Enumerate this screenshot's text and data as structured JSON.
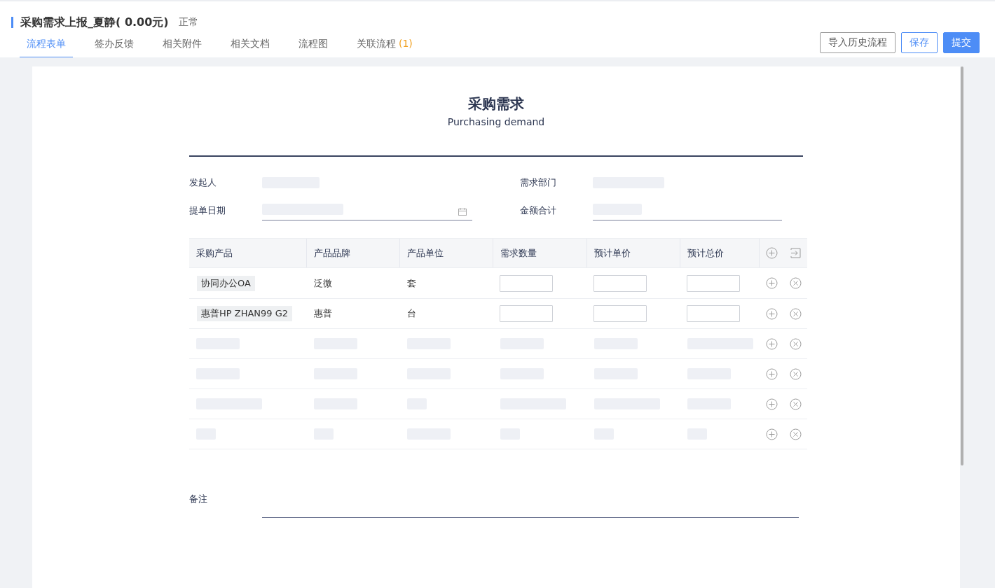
{
  "header": {
    "title": "采购需求上报_夏静( 0.00元)",
    "status": "正常"
  },
  "tabs": [
    {
      "label": "流程表单",
      "selected": true
    },
    {
      "label": "签办反馈",
      "selected": false
    },
    {
      "label": "相关附件",
      "selected": false
    },
    {
      "label": "相关文档",
      "selected": false
    },
    {
      "label": "流程图",
      "selected": false
    },
    {
      "label": "关联流程",
      "count": "(1)",
      "selected": false
    }
  ],
  "actions": [
    {
      "label": "导入历史流程",
      "kind": "default"
    },
    {
      "label": "保存",
      "kind": "outline"
    },
    {
      "label": "提交",
      "kind": "primary"
    }
  ],
  "form": {
    "title": "采购需求",
    "subtitle": "Purchasing demand",
    "fields": [
      {
        "label": "发起人",
        "kind": "readonly"
      },
      {
        "label": "需求部门",
        "kind": "readonly"
      },
      {
        "label": "提单日期",
        "kind": "date"
      },
      {
        "label": "金额合计",
        "kind": "input"
      }
    ],
    "table": {
      "columns": [
        "采购产品",
        "产品品牌",
        "产品单位",
        "需求数量",
        "预计单价",
        "预计总价"
      ],
      "rows": [
        {
          "kind": "item",
          "product": "协同办公OA",
          "brand": "泛微",
          "unit": "套"
        },
        {
          "kind": "item",
          "product": "惠普HP ZHAN99 G2",
          "brand": "惠普",
          "unit": "台"
        },
        {
          "kind": "placeholder"
        },
        {
          "kind": "placeholder"
        },
        {
          "kind": "placeholder"
        },
        {
          "kind": "placeholder"
        }
      ]
    },
    "remarks": {
      "label": "备注"
    }
  }
}
